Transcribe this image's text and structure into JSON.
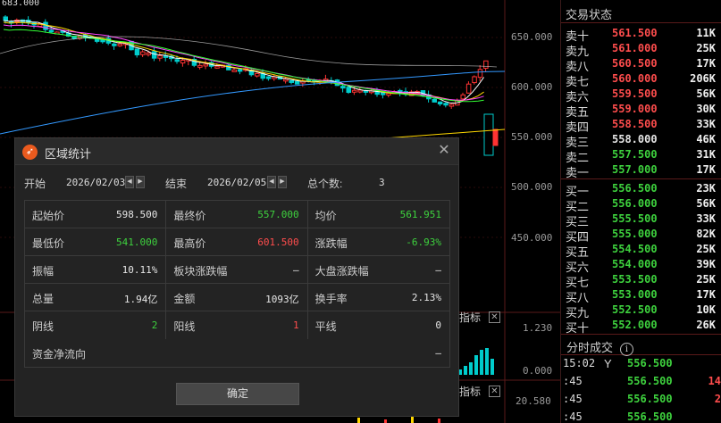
{
  "chart": {
    "top_price": "683.000",
    "price_ticks": [
      "650.000",
      "600.000",
      "550.000",
      "500.000",
      "450.000"
    ],
    "sub_ticks": [
      "1.230",
      "0.000",
      "20.580"
    ],
    "indicator_label": "指标",
    "indicator_label_2": "指标",
    "colors": {
      "up": "#ff3333",
      "down": "#00cccc",
      "ma5": "#ffffff",
      "ma10": "#ffd700",
      "ma20": "#ff44ff",
      "ma30": "#33ff33",
      "ma60": "#3399ff"
    }
  },
  "order_book": {
    "title": "交易状态",
    "sells": [
      {
        "label": "卖十",
        "price": "561.500",
        "vol": "11K",
        "color": "red"
      },
      {
        "label": "卖九",
        "price": "561.000",
        "vol": "25K",
        "color": "red"
      },
      {
        "label": "卖八",
        "price": "560.500",
        "vol": "17K",
        "color": "red"
      },
      {
        "label": "卖七",
        "price": "560.000",
        "vol": "206K",
        "color": "red"
      },
      {
        "label": "卖六",
        "price": "559.500",
        "vol": "56K",
        "color": "red"
      },
      {
        "label": "卖五",
        "price": "559.000",
        "vol": "30K",
        "color": "red"
      },
      {
        "label": "卖四",
        "price": "558.500",
        "vol": "33K",
        "color": "red"
      },
      {
        "label": "卖三",
        "price": "558.000",
        "vol": "46K",
        "color": "white"
      },
      {
        "label": "卖二",
        "price": "557.500",
        "vol": "31K",
        "color": "green"
      },
      {
        "label": "卖一",
        "price": "557.000",
        "vol": "17K",
        "color": "green"
      }
    ],
    "buys": [
      {
        "label": "买一",
        "price": "556.500",
        "vol": "23K",
        "color": "green"
      },
      {
        "label": "买二",
        "price": "556.000",
        "vol": "56K",
        "color": "green"
      },
      {
        "label": "买三",
        "price": "555.500",
        "vol": "33K",
        "color": "green"
      },
      {
        "label": "买四",
        "price": "555.000",
        "vol": "82K",
        "color": "green"
      },
      {
        "label": "买五",
        "price": "554.500",
        "vol": "25K",
        "color": "green"
      },
      {
        "label": "买六",
        "price": "554.000",
        "vol": "39K",
        "color": "green"
      },
      {
        "label": "买七",
        "price": "553.500",
        "vol": "25K",
        "color": "green"
      },
      {
        "label": "买八",
        "price": "553.000",
        "vol": "17K",
        "color": "green"
      },
      {
        "label": "买九",
        "price": "552.500",
        "vol": "10K",
        "color": "green"
      },
      {
        "label": "买十",
        "price": "552.000",
        "vol": "26K",
        "color": "green"
      }
    ],
    "trades_title": "分时成交",
    "info_icon": "i",
    "trades": [
      {
        "time": "15:02",
        "dir": "Y",
        "price": "556.500",
        "vol": "",
        "vcolor": "red"
      },
      {
        "time": ":45",
        "dir": "",
        "price": "556.500",
        "vol": "14",
        "vcolor": "red"
      },
      {
        "time": ":45",
        "dir": "",
        "price": "556.500",
        "vol": "2",
        "vcolor": "red"
      },
      {
        "time": ":45",
        "dir": "",
        "price": "556.500",
        "vol": "",
        "vcolor": "red"
      }
    ]
  },
  "dialog": {
    "title": "区域统计",
    "close": "✕",
    "start_label": "开始",
    "start_date": "2026/02/03",
    "end_label": "结束",
    "end_date": "2026/02/05",
    "count_label": "总个数:",
    "count_value": "3",
    "stats": [
      [
        {
          "k": "起始价",
          "v": "598.500",
          "c": ""
        },
        {
          "k": "最终价",
          "v": "557.000",
          "c": "green"
        },
        {
          "k": "均价",
          "v": "561.951",
          "c": "green"
        }
      ],
      [
        {
          "k": "最低价",
          "v": "541.000",
          "c": "green"
        },
        {
          "k": "最高价",
          "v": "601.500",
          "c": "red"
        },
        {
          "k": "涨跌幅",
          "v": "-6.93%",
          "c": "green"
        }
      ],
      [
        {
          "k": "振幅",
          "v": "10.11%",
          "c": ""
        },
        {
          "k": "板块涨跌幅",
          "v": "–",
          "c": ""
        },
        {
          "k": "大盘涨跌幅",
          "v": "–",
          "c": ""
        }
      ],
      [
        {
          "k": "总量",
          "v": "1.94亿",
          "c": ""
        },
        {
          "k": "金额",
          "v": "1093亿",
          "c": ""
        },
        {
          "k": "换手率",
          "v": "2.13%",
          "c": ""
        }
      ],
      [
        {
          "k": "阴线",
          "v": "2",
          "c": "green"
        },
        {
          "k": "阳线",
          "v": "1",
          "c": "red"
        },
        {
          "k": "平线",
          "v": "0",
          "c": ""
        }
      ]
    ],
    "fund_flow_label": "资金净流向",
    "fund_flow_value": "–",
    "ok_label": "确定"
  }
}
